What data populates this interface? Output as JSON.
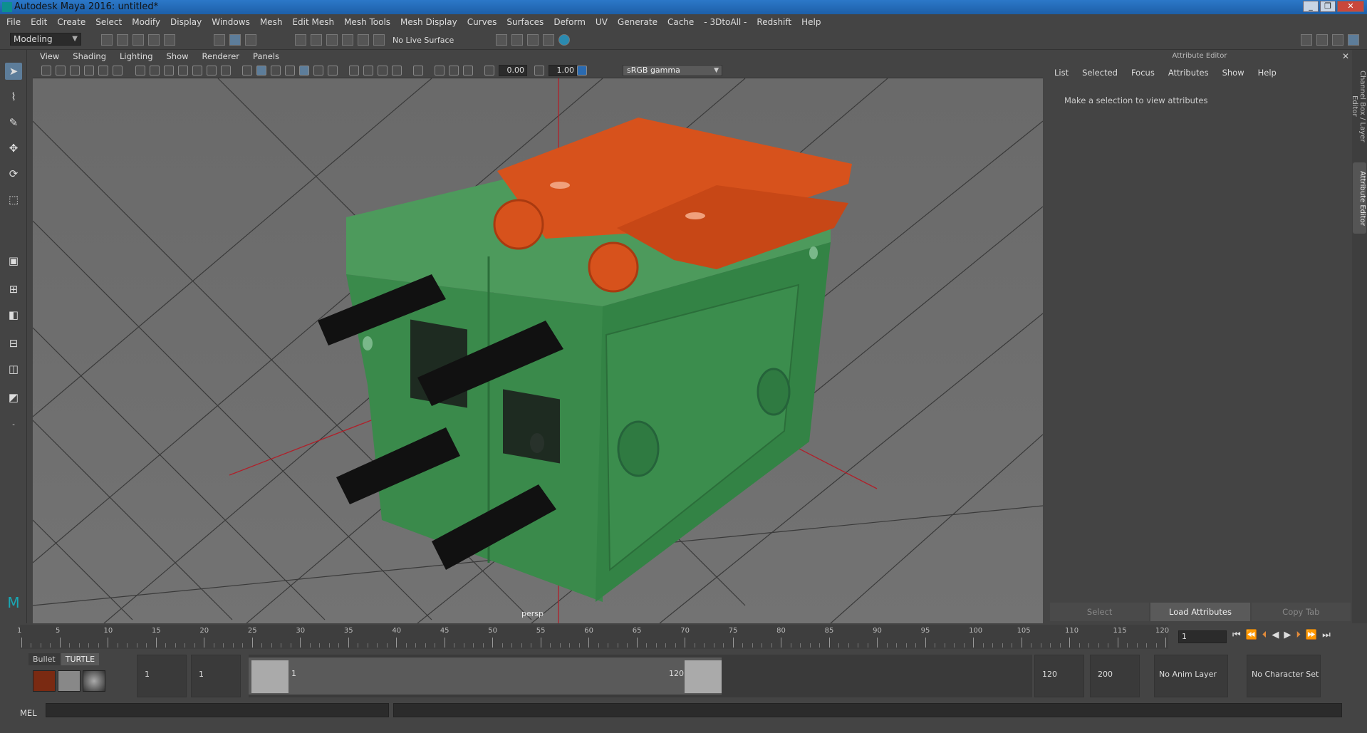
{
  "window": {
    "title": "Autodesk Maya 2016: untitled*"
  },
  "menubar": [
    "File",
    "Edit",
    "Create",
    "Select",
    "Modify",
    "Display",
    "Windows",
    "Mesh",
    "Edit Mesh",
    "Mesh Tools",
    "Mesh Display",
    "Curves",
    "Surfaces",
    "Deform",
    "UV",
    "Generate",
    "Cache",
    "- 3DtoAll -",
    "Redshift",
    "Help"
  ],
  "shelf": {
    "mode": "Modeling",
    "live_surface": "No Live Surface"
  },
  "viewport": {
    "menu": [
      "View",
      "Shading",
      "Lighting",
      "Show",
      "Renderer",
      "Panels"
    ],
    "field_a": "0.00",
    "field_b": "1.00",
    "colorspace": "sRGB gamma",
    "camera_label": "persp"
  },
  "attribute_editor": {
    "title": "Attribute Editor",
    "menu": [
      "List",
      "Selected",
      "Focus",
      "Attributes",
      "Show",
      "Help"
    ],
    "message": "Make a selection to view attributes",
    "buttons": [
      "Select",
      "Load Attributes",
      "Copy Tab"
    ]
  },
  "side_tabs": [
    "Channel Box / Layer Editor",
    "Attribute Editor"
  ],
  "timeline": {
    "labels": [
      "1",
      "5",
      "10",
      "15",
      "20",
      "25",
      "30",
      "35",
      "40",
      "45",
      "50",
      "55",
      "60",
      "65",
      "70",
      "75",
      "80",
      "85",
      "90",
      "95",
      "100",
      "105",
      "110",
      "115",
      "120"
    ],
    "current_frame": "1"
  },
  "shelf_tabs": [
    "Bullet",
    "TURTLE"
  ],
  "range": {
    "start": "1",
    "playback_start": "1",
    "slider_start_label": "1",
    "slider_end_label": "120",
    "playback_end": "120",
    "end": "200",
    "anim_layer": "No Anim Layer",
    "character_set": "No Character Set"
  },
  "cmdline": {
    "label": "MEL"
  },
  "colors": {
    "green_object": "#3b8a4c",
    "orange_object": "#d7521c",
    "viewport_bg": "#6c6c6c"
  }
}
